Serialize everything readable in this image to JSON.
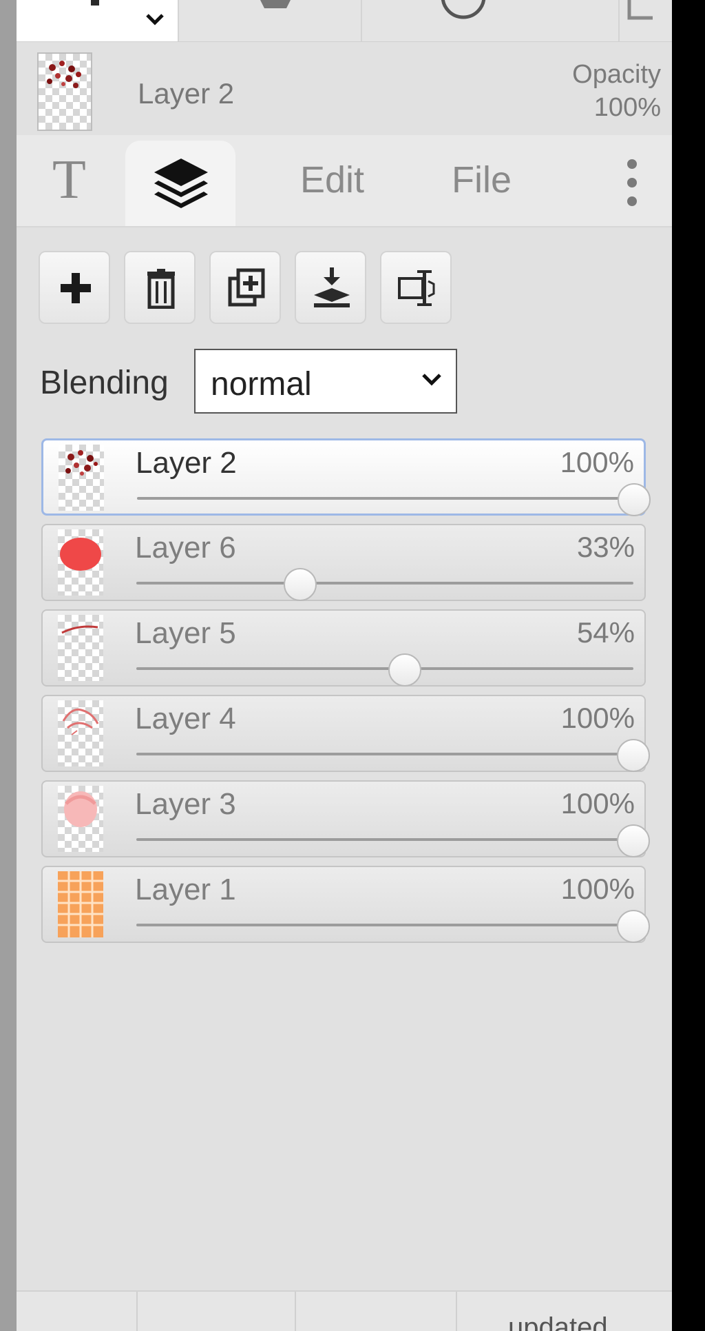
{
  "info": {
    "layer_name": "Layer 2",
    "opacity_label": "Opacity",
    "opacity_value": "100%"
  },
  "tabs": [
    {
      "label": "T",
      "icon": "text-tool-icon"
    },
    {
      "label": "",
      "icon": "layers-icon"
    },
    {
      "label": "Edit"
    },
    {
      "label": "File"
    },
    {
      "label": "",
      "icon": "more-vertical-icon"
    }
  ],
  "actions": [
    {
      "icon": "add-layer-icon"
    },
    {
      "icon": "delete-layer-icon"
    },
    {
      "icon": "duplicate-layer-icon"
    },
    {
      "icon": "merge-down-icon"
    },
    {
      "icon": "rename-layer-icon"
    }
  ],
  "blending": {
    "label": "Blending",
    "value": "normal"
  },
  "layers": [
    {
      "name": "Layer 2",
      "opacity": "100%",
      "opacity_value": 1.0,
      "selected": true,
      "thumb": "dots"
    },
    {
      "name": "Layer 6",
      "opacity": "33%",
      "opacity_value": 0.33,
      "selected": false,
      "thumb": "red-blob"
    },
    {
      "name": "Layer 5",
      "opacity": "54%",
      "opacity_value": 0.54,
      "selected": false,
      "thumb": "line"
    },
    {
      "name": "Layer 4",
      "opacity": "100%",
      "opacity_value": 1.0,
      "selected": false,
      "thumb": "sketch"
    },
    {
      "name": "Layer 3",
      "opacity": "100%",
      "opacity_value": 1.0,
      "selected": false,
      "thumb": "pink-face"
    },
    {
      "name": "Layer 1",
      "opacity": "100%",
      "opacity_value": 1.0,
      "selected": false,
      "thumb": "orange-grid"
    }
  ],
  "footer": {
    "status_text": "updated"
  },
  "colors": {
    "selection_border": "#9db8e6",
    "panel_bg": "#e1e1e1"
  }
}
